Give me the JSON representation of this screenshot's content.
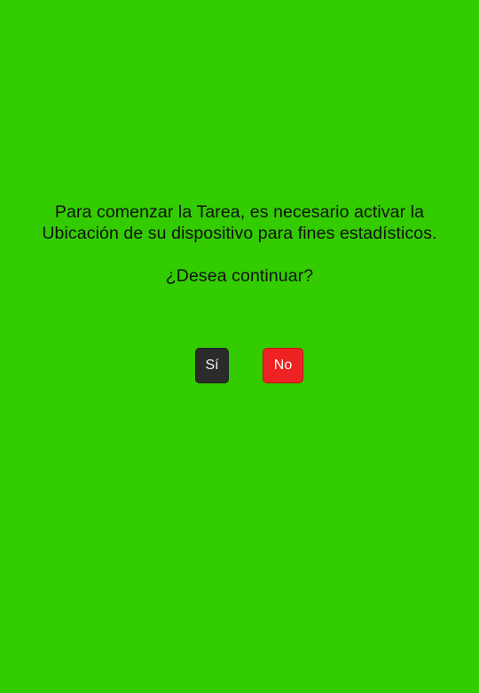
{
  "dialog": {
    "message_lines": [
      "Para comenzar la Tarea, es necesario activar la",
      "Ubicación de su dispositivo para fines estadísticos."
    ],
    "question": "¿Desea continuar?",
    "yes_label": "Sí",
    "no_label": "No"
  },
  "colors": {
    "background": "#33cc00",
    "yes_button": "#2b2b2b",
    "no_button": "#ee2222",
    "text": "#111111"
  }
}
